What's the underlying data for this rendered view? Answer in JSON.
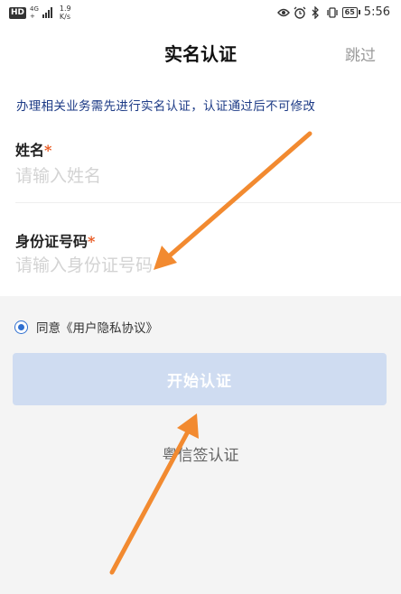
{
  "status_bar": {
    "hd": "HD",
    "network_top": "4G",
    "network_bottom": "+",
    "speed_value": "1.9",
    "speed_unit": "K/s",
    "battery": "65",
    "time": "5:56",
    "icons": [
      "eye-icon",
      "alarm-icon",
      "bluetooth-icon",
      "vibrate-icon"
    ]
  },
  "header": {
    "title": "实名认证",
    "skip_label": "跳过"
  },
  "notice": "办理相关业务需先进行实名认证，认证通过后不可修改",
  "form": {
    "name_label": "姓名",
    "name_placeholder": "请输入姓名",
    "id_label": "身份证号码",
    "id_placeholder": "请输入身份证号码",
    "required_mark": "*"
  },
  "agreement": {
    "prefix": "同意",
    "link": "《用户隐私协议》",
    "checked": true
  },
  "start_button": "开始认证",
  "alt_auth": "粤信签认证",
  "colors": {
    "accent": "#2f6fd0",
    "required": "#e8561d",
    "notice": "#1d3b86",
    "button_bg": "#cfdcf1",
    "arrow": "#f28a30"
  }
}
